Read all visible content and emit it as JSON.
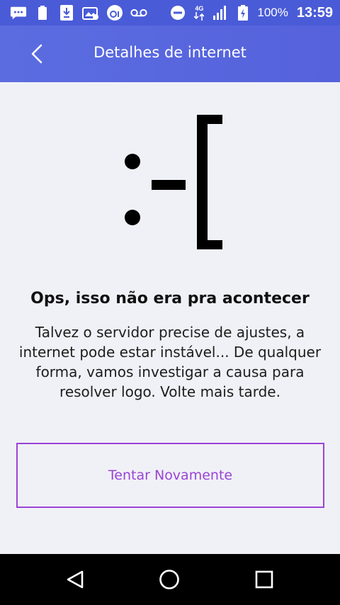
{
  "status_bar": {
    "battery_percent": "100%",
    "time": "13:59",
    "network_type": "4G",
    "background_color": "#4a5bd7",
    "icons_left": [
      "chat-bubble-icon",
      "battery-small-icon",
      "download-icon",
      "gallery-icon",
      "oi-app-icon",
      "voicemail-icon"
    ],
    "icons_right": [
      "do-not-disturb-icon",
      "data-transfer-icon",
      "signal-icon",
      "battery-charging-icon"
    ]
  },
  "app_bar": {
    "title": "Detalhes de internet",
    "back_icon": "chevron-left-icon",
    "color": "#5b6ce0"
  },
  "error": {
    "emoticon": ":-[",
    "heading": "Ops, isso não era pra acontecer",
    "lines": [
      "Talvez o servidor precise de ajustes, a",
      "internet pode estar instável... De qualquer",
      "forma, vamos investigar a causa para",
      "resolver logo. Volte mais tarde."
    ]
  },
  "actions": {
    "retry_label": "Tentar Novamente",
    "accent_color": "#9b44d6"
  },
  "nav_bar": {
    "icons": [
      "back-triangle-icon",
      "home-circle-icon",
      "recents-square-icon"
    ]
  }
}
